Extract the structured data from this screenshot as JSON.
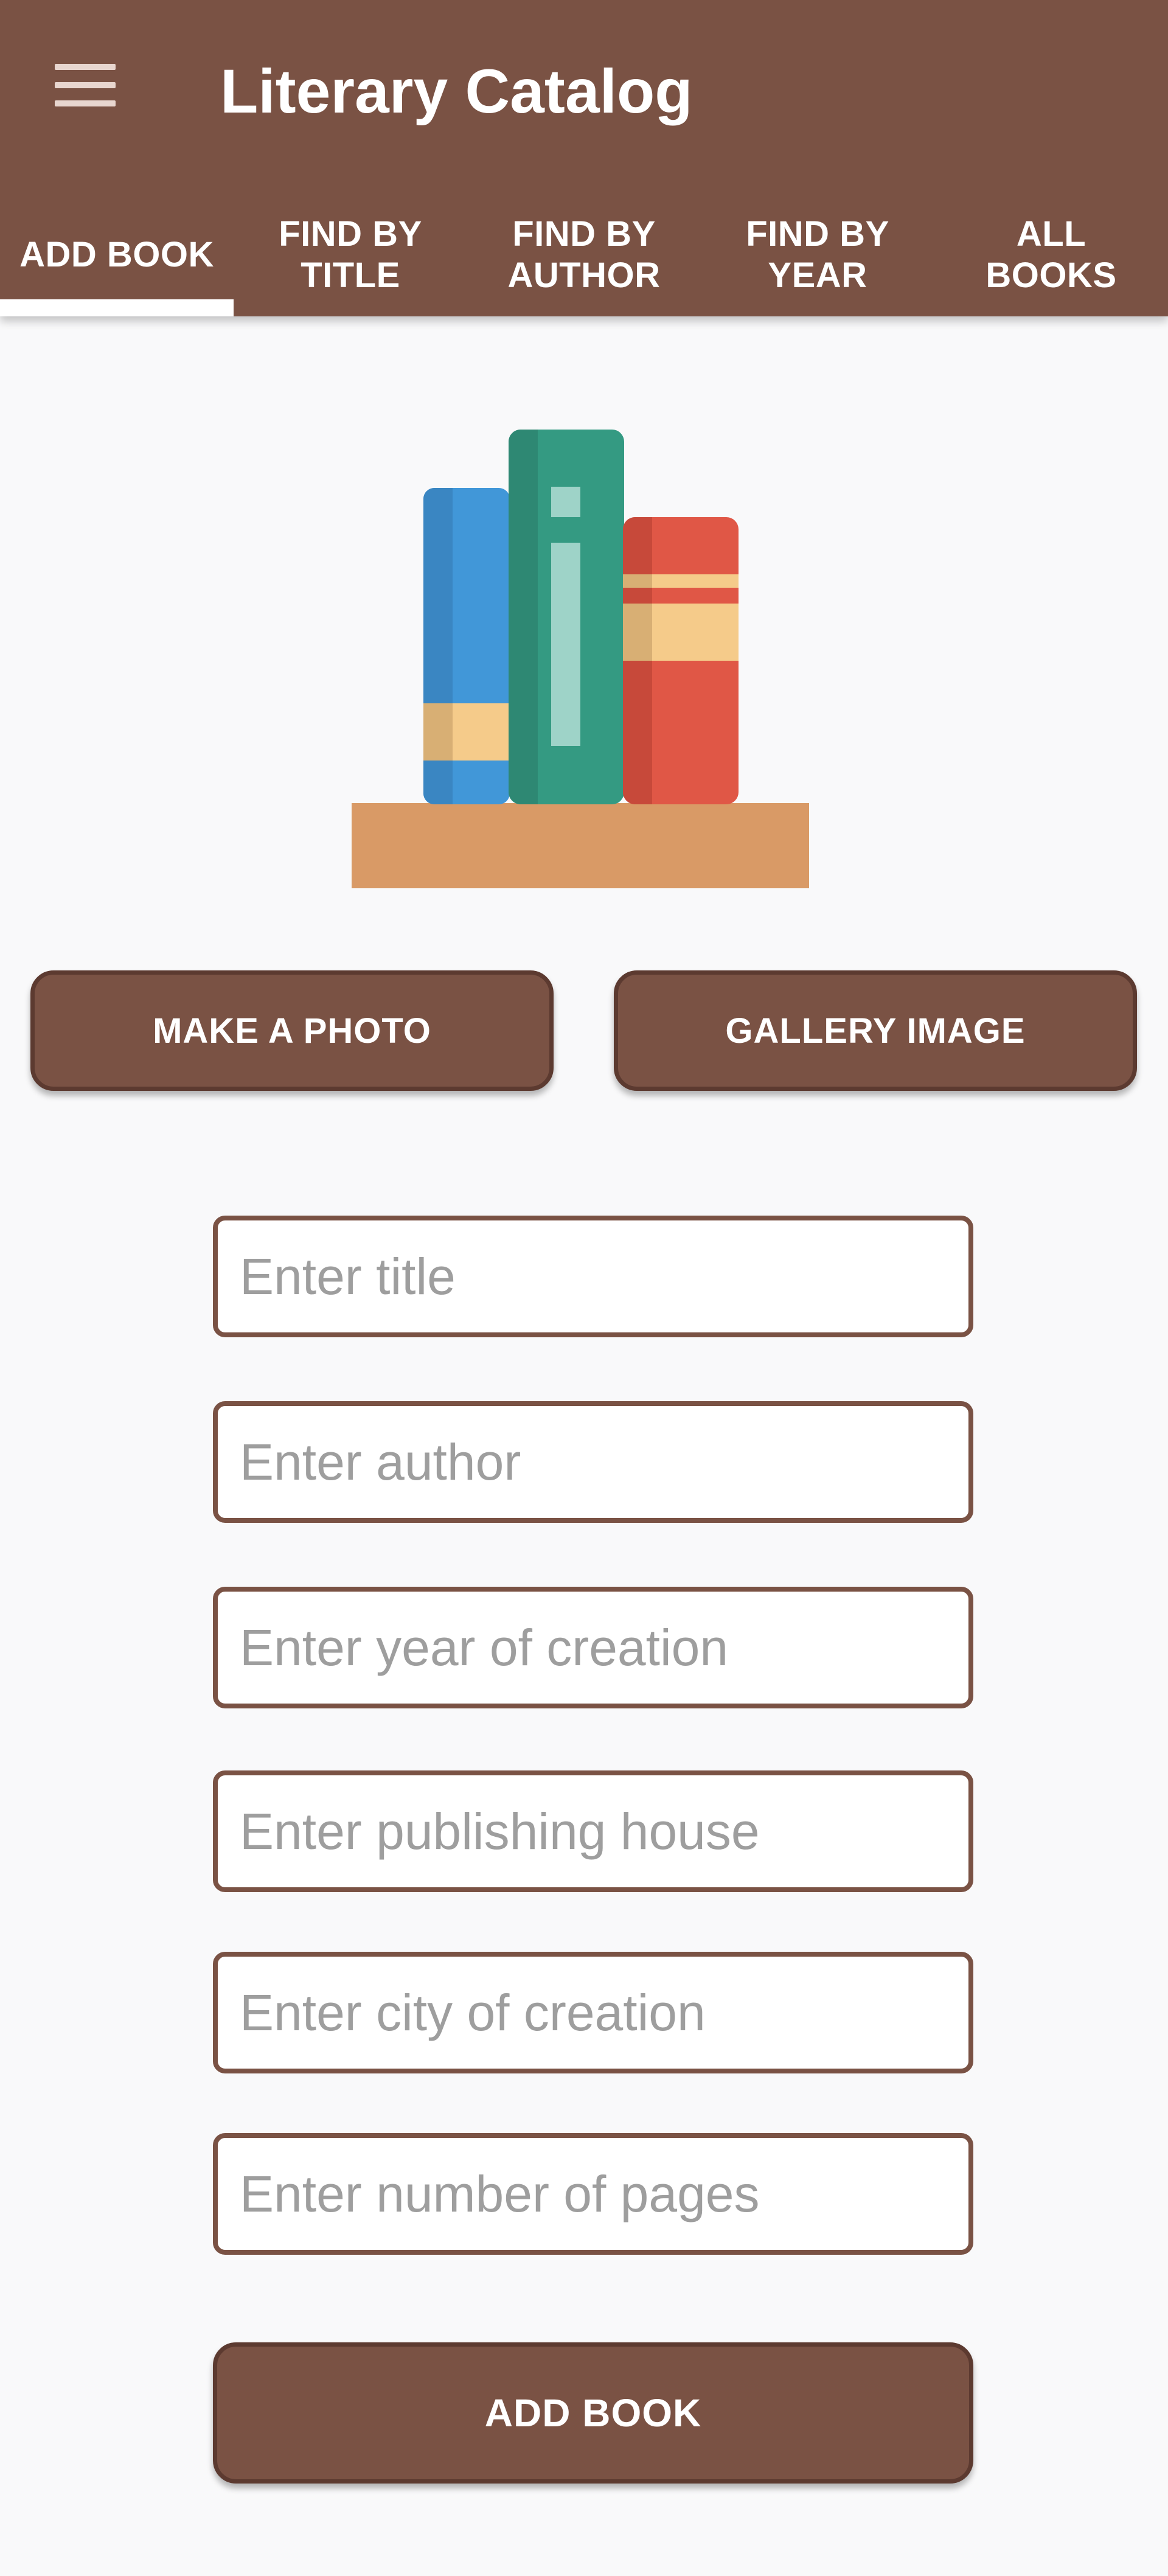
{
  "app": {
    "title": "Literary Catalog",
    "menu_icon": "hamburger-menu-icon"
  },
  "tabs": [
    {
      "label": "ADD BOOK",
      "active": true
    },
    {
      "label": "FIND BY TITLE",
      "active": false
    },
    {
      "label": "FIND BY AUTHOR",
      "active": false
    },
    {
      "label": "FIND BY YEAR",
      "active": false
    },
    {
      "label": "ALL BOOKS",
      "active": false
    }
  ],
  "illustration": {
    "icon": "books-on-shelf-icon"
  },
  "image_buttons": {
    "photo_label": "MAKE A PHOTO",
    "gallery_label": "GALLERY IMAGE"
  },
  "form": {
    "title_placeholder": "Enter title",
    "author_placeholder": "Enter author",
    "year_placeholder": "Enter year of creation",
    "publisher_placeholder": "Enter publishing house",
    "city_placeholder": "Enter city of creation",
    "pages_placeholder": "Enter number of pages",
    "title_value": "",
    "author_value": "",
    "year_value": "",
    "publisher_value": "",
    "city_value": "",
    "pages_value": ""
  },
  "submit": {
    "label": "ADD BOOK"
  },
  "colors": {
    "primary": "#7A5244",
    "primary_dark": "#5C3A30",
    "background": "#F9F9FA",
    "on_primary": "#FFFFFF",
    "placeholder": "#9E9E9E"
  }
}
